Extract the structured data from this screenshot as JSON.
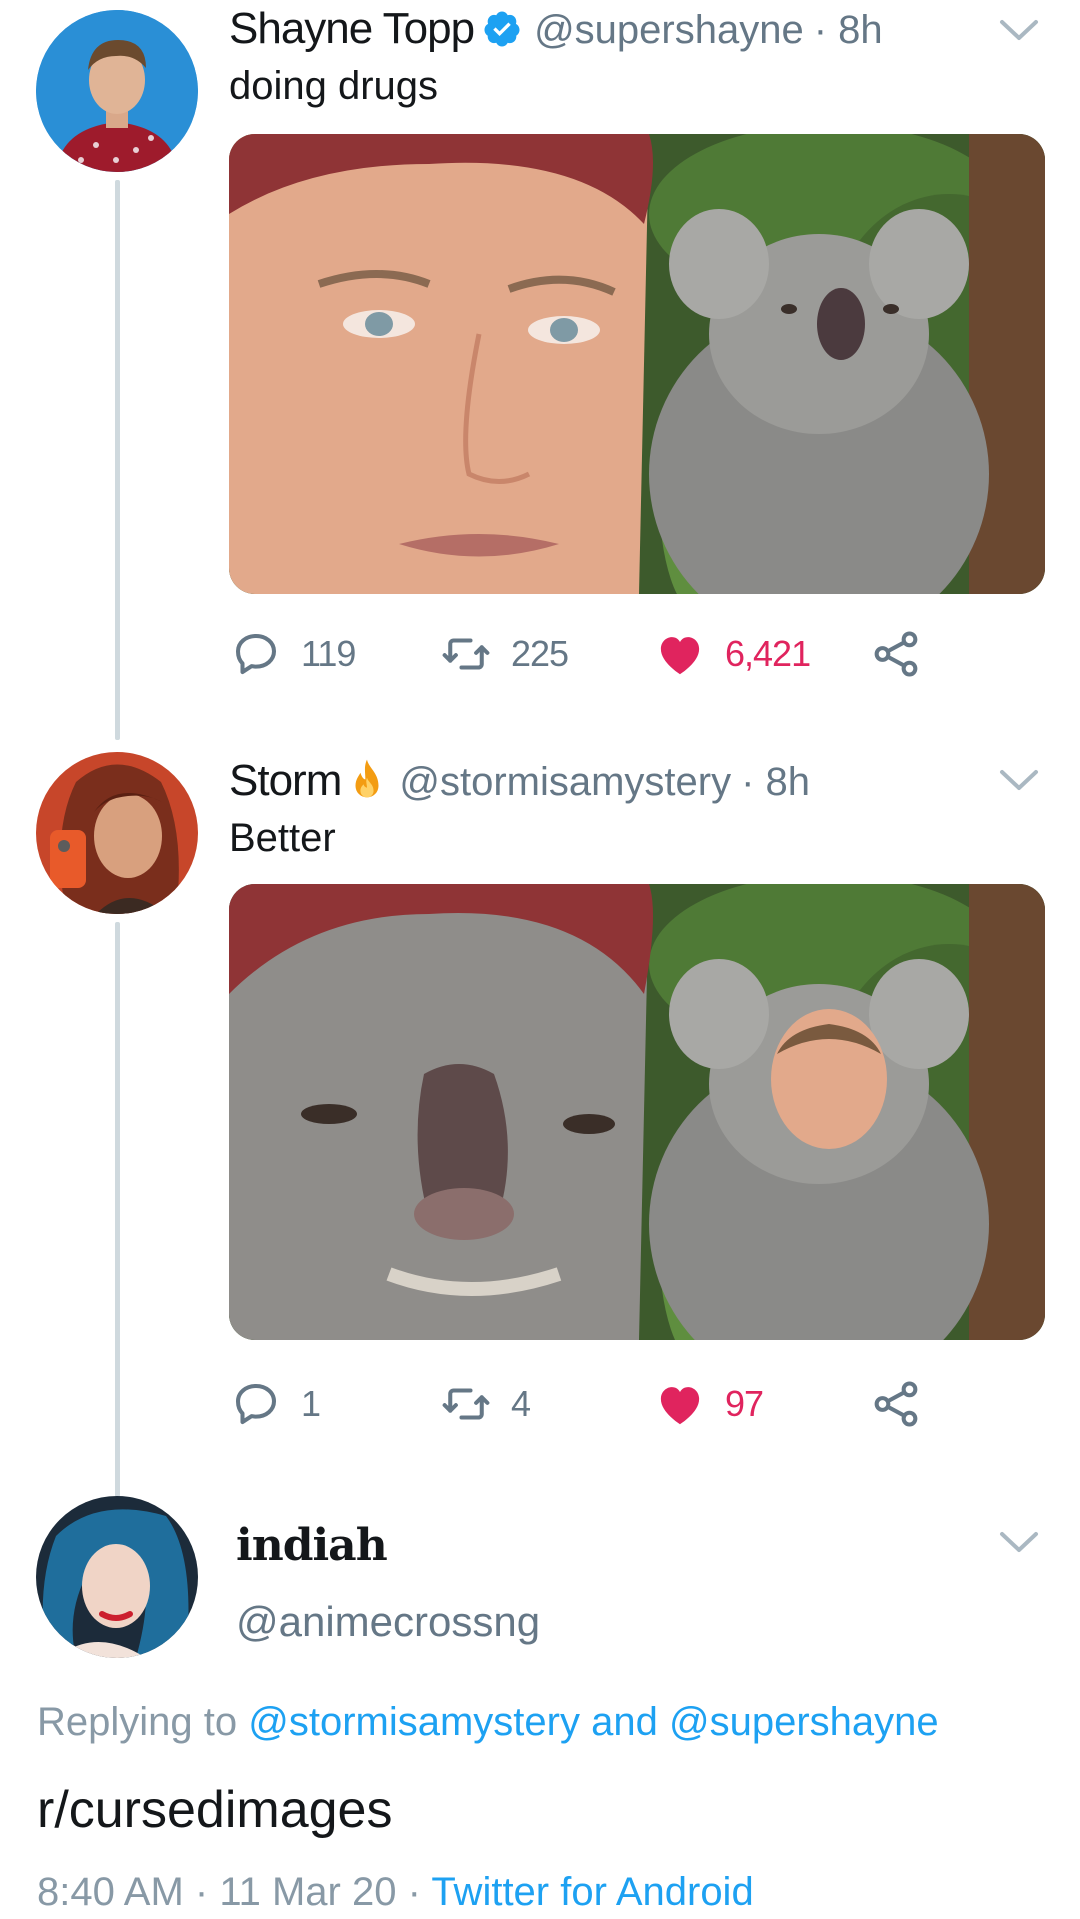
{
  "tweets": [
    {
      "name": "Shayne Topp",
      "handle": "@supershayne",
      "time": "· 8h",
      "text": "doing drugs",
      "verified": true,
      "stats": {
        "replies": "119",
        "retweets": "225",
        "likes": "6,421"
      },
      "liked": true,
      "avatar_icon": "person-avatar",
      "media_description_icon": "photo"
    },
    {
      "name": "Storm",
      "handle": "@stormisamystery",
      "time": "· 8h",
      "text": "Better",
      "emoji_icon": "fire-emoji",
      "stats": {
        "replies": "1",
        "retweets": "4",
        "likes": "97"
      },
      "liked": true,
      "avatar_icon": "person-avatar",
      "media_description_icon": "photo"
    }
  ],
  "reply": {
    "name": "indiah",
    "handle": "@animecrossng",
    "replying_prefix": "Replying to",
    "replying_to_1": "@stormisamystery",
    "replying_and": "and",
    "replying_to_2": "@supershayne",
    "text": "r/cursedimages",
    "time": "8:40 AM",
    "sep1": "·",
    "date": "11 Mar 20",
    "sep2": "·",
    "source": "Twitter for Android"
  },
  "colors": {
    "text": "#14171a",
    "secondary": "#657786",
    "link": "#1da1f2",
    "like": "#e0245e",
    "thread_line": "#cfd9de"
  }
}
